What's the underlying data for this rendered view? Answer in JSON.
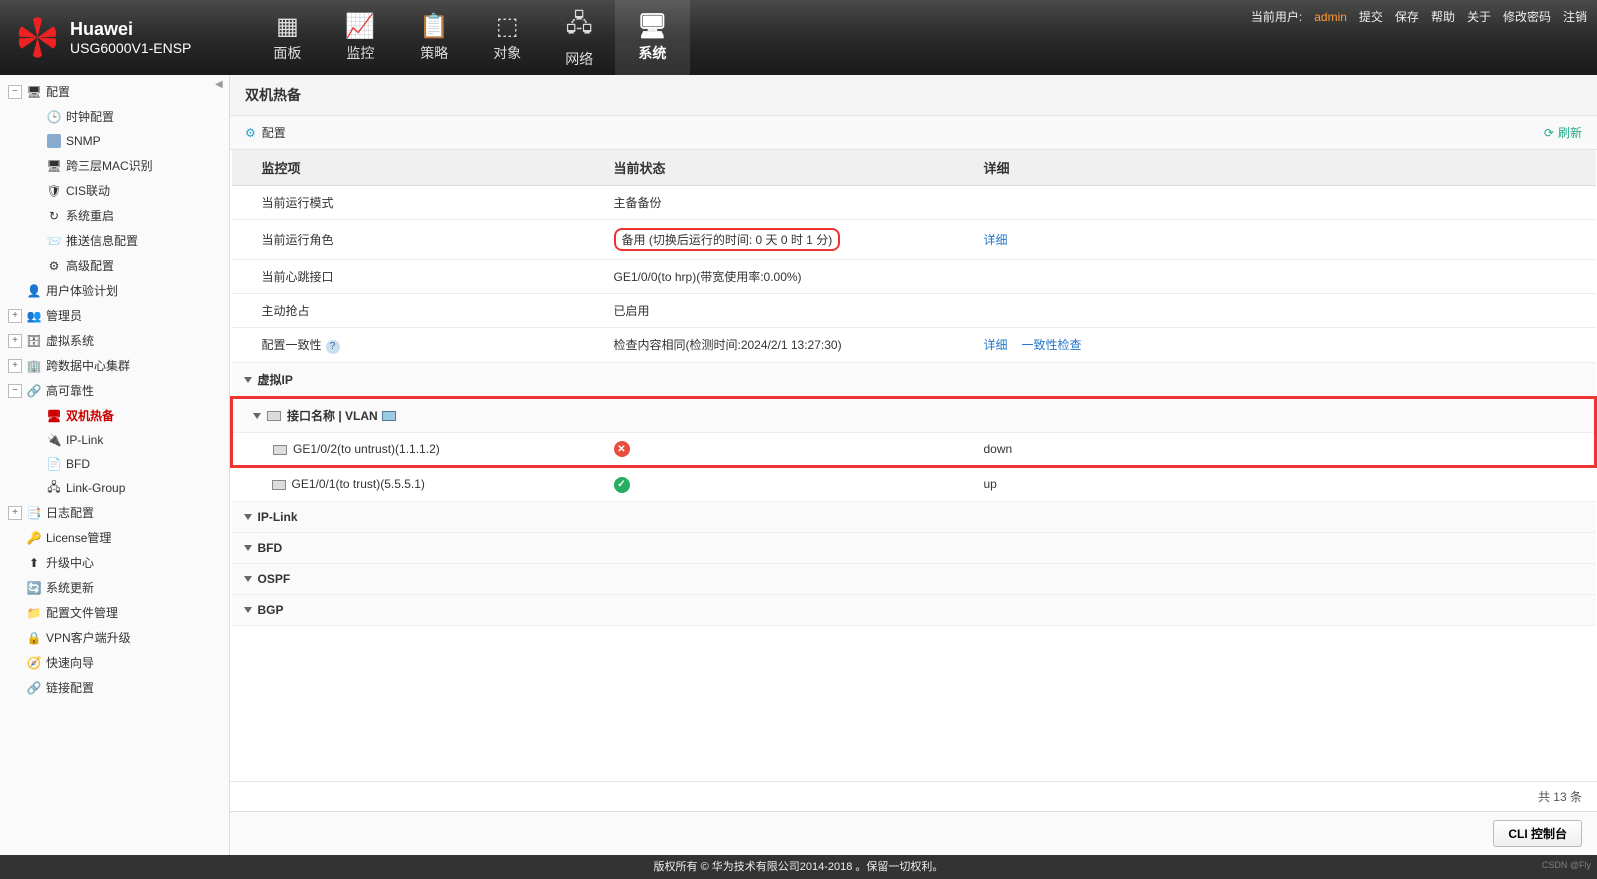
{
  "brand": {
    "title": "Huawei",
    "model": "USG6000V1-ENSP"
  },
  "topnav": [
    {
      "label": "面板"
    },
    {
      "label": "监控"
    },
    {
      "label": "策略"
    },
    {
      "label": "对象"
    },
    {
      "label": "网络"
    },
    {
      "label": "系统",
      "active": true
    }
  ],
  "topright": {
    "cur_user_label": "当前用户:",
    "user": "admin",
    "links": [
      "提交",
      "保存",
      "帮助",
      "关于",
      "修改密码",
      "注销"
    ]
  },
  "sidebar": {
    "root_label": "配置",
    "config_children": [
      "时钟配置",
      "SNMP",
      "跨三层MAC识别",
      "CIS联动",
      "系统重启",
      "推送信息配置",
      "高级配置"
    ],
    "nodes": [
      {
        "label": "用户体验计划",
        "expand": null
      },
      {
        "label": "管理员",
        "expand": "plus"
      },
      {
        "label": "虚拟系统",
        "expand": "plus"
      },
      {
        "label": "跨数据中心集群",
        "expand": "plus"
      }
    ],
    "ha_label": "高可靠性",
    "ha_children": [
      {
        "label": "双机热备",
        "active": true
      },
      {
        "label": "IP-Link"
      },
      {
        "label": "BFD"
      },
      {
        "label": "Link-Group"
      }
    ],
    "logcfg_label": "日志配置",
    "tail": [
      "License管理",
      "升级中心",
      "系统更新",
      "配置文件管理",
      "VPN客户端升级",
      "快速向导",
      "链接配置"
    ]
  },
  "page": {
    "title": "双机热备",
    "config_label": "配置",
    "refresh_label": "刷新",
    "columns": {
      "monitor": "监控项",
      "status": "当前状态",
      "detail": "详细"
    },
    "rows": {
      "mode": {
        "k": "当前运行模式",
        "v": "主备备份"
      },
      "role": {
        "k": "当前运行角色",
        "v": "备用 (切换后运行的时间: 0 天 0 时 1 分)",
        "link": "详细"
      },
      "heartbeat": {
        "k": "当前心跳接口",
        "v": "GE1/0/0(to hrp)(带宽使用率:0.00%)"
      },
      "preempt": {
        "k": "主动抢占",
        "v": "已启用"
      },
      "consist": {
        "k": "配置一致性",
        "v": "检查内容相同(检测时间:2024/2/1 13:27:30)",
        "link1": "详细",
        "link2": "一致性检查"
      }
    },
    "sections": {
      "vip": "虚拟IP",
      "ifvlan": "接口名称 | VLAN",
      "iplink": "IP-Link",
      "bfd": "BFD",
      "ospf": "OSPF",
      "bgp": "BGP"
    },
    "interfaces": [
      {
        "name": "GE1/0/2(to untrust)(1.1.1.2)",
        "state": "down",
        "state_label": "down"
      },
      {
        "name": "GE1/0/1(to trust)(5.5.5.1)",
        "state": "up",
        "state_label": "up"
      }
    ],
    "total_label": "共 13 条",
    "cli_label": "CLI 控制台"
  },
  "footer": "版权所有 © 华为技术有限公司2014-2018 。保留一切权利。",
  "watermark": "CSDN @Fly"
}
